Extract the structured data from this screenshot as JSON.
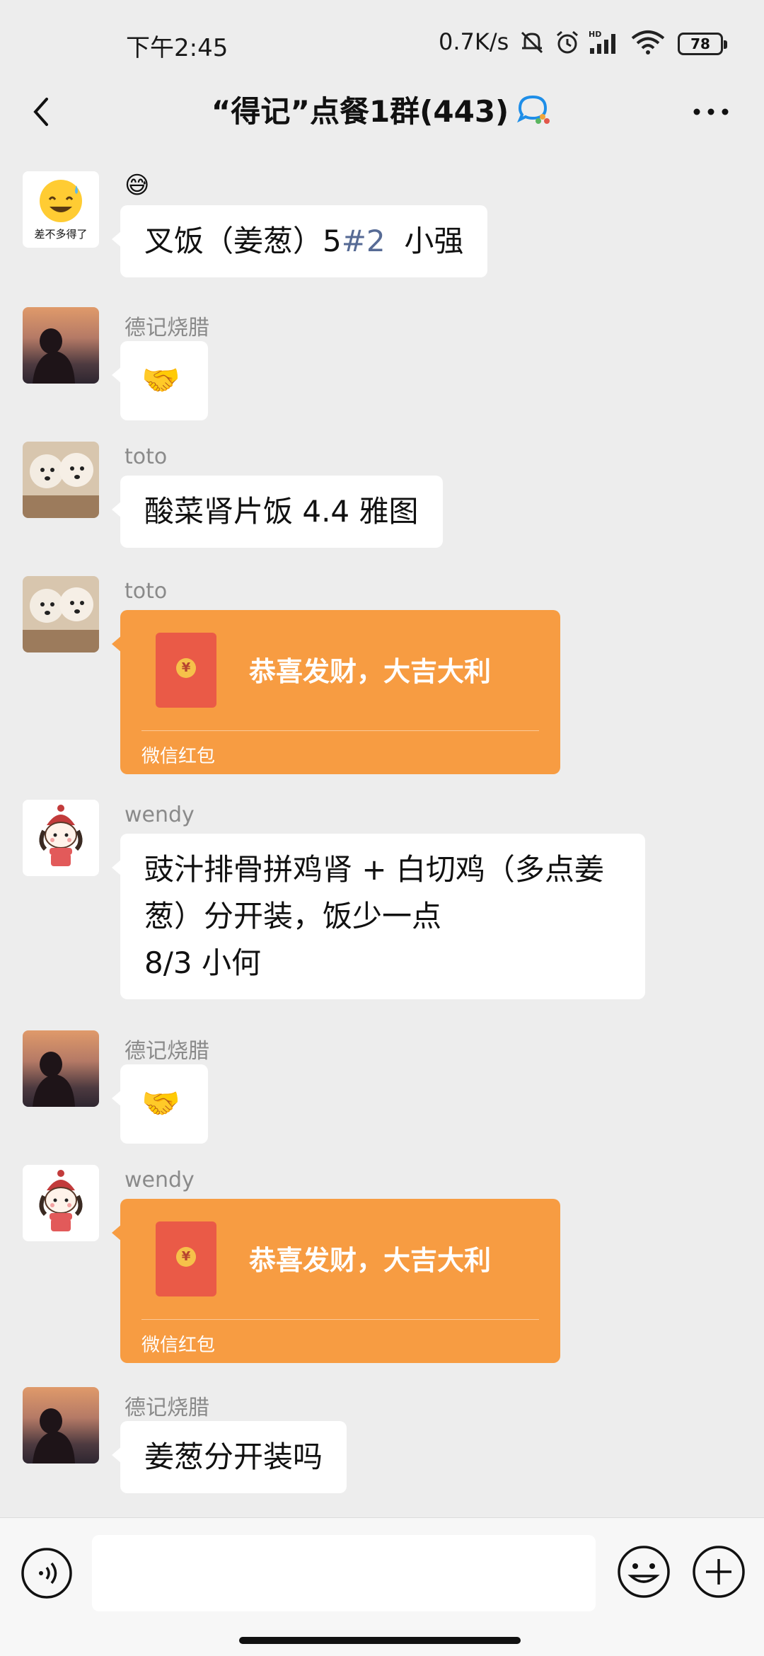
{
  "status_bar": {
    "time": "下午2:45",
    "net_speed": "0.7K/s",
    "battery": "78"
  },
  "header": {
    "title": "“得记”点餐1群(443)",
    "back_icon": "chevron-left-icon",
    "more_icon": "more-icon"
  },
  "messages": [
    {
      "type": "text",
      "sender": "",
      "avatar_text": "差不多得了",
      "emoji_line": "😅",
      "text_main": "叉饭（姜葱）5",
      "text_hash": "#2",
      "text_tail": "  小强"
    },
    {
      "type": "emoji",
      "sender": "德记烧腊",
      "text": "🤝"
    },
    {
      "type": "text",
      "sender": "toto",
      "text": "酸菜肾片饭 4.4 雅图"
    },
    {
      "type": "redpacket",
      "sender": "toto",
      "text": "恭喜发财，大吉大利",
      "label": "微信红包"
    },
    {
      "type": "text",
      "sender": "wendy",
      "lines": [
        "豉汁排骨拼鸡肾 + 白切鸡（多点姜",
        "葱）分开装，饭少一点",
        "8/3 小何"
      ]
    },
    {
      "type": "emoji",
      "sender": "德记烧腊",
      "text": "🤝"
    },
    {
      "type": "redpacket",
      "sender": "wendy",
      "text": "恭喜发财，大吉大利",
      "label": "微信红包"
    },
    {
      "type": "text",
      "sender": "德记烧腊",
      "text": "姜葱分开装吗"
    }
  ],
  "input_bar": {
    "placeholder": "",
    "voice_icon": "voice-icon",
    "emoji_icon": "emoji-icon",
    "plus_icon": "plus-icon"
  }
}
